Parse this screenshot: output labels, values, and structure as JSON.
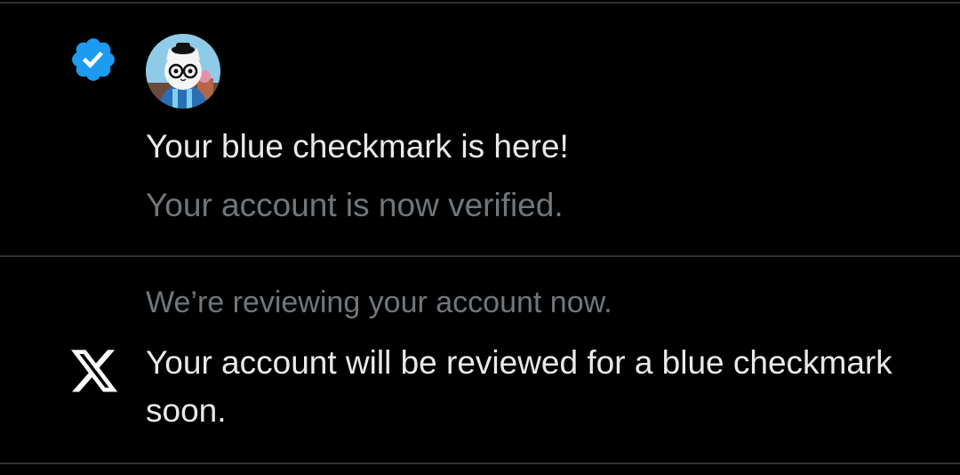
{
  "notifications": [
    {
      "icon": "verified-badge-icon",
      "avatar": "profile-avatar-cat-with-glasses",
      "title": "Your blue checkmark is here!",
      "body": "Your account is now verified."
    },
    {
      "icon": "x-logo-icon",
      "context": "We’re reviewing your account now.",
      "body": "Your account will be reviewed for a blue checkmark soon."
    }
  ],
  "colors": {
    "background": "#000000",
    "divider": "#2f3336",
    "primary_text": "#e7e9ea",
    "secondary_text": "#71767b",
    "verified_blue": "#1d9bf0"
  }
}
